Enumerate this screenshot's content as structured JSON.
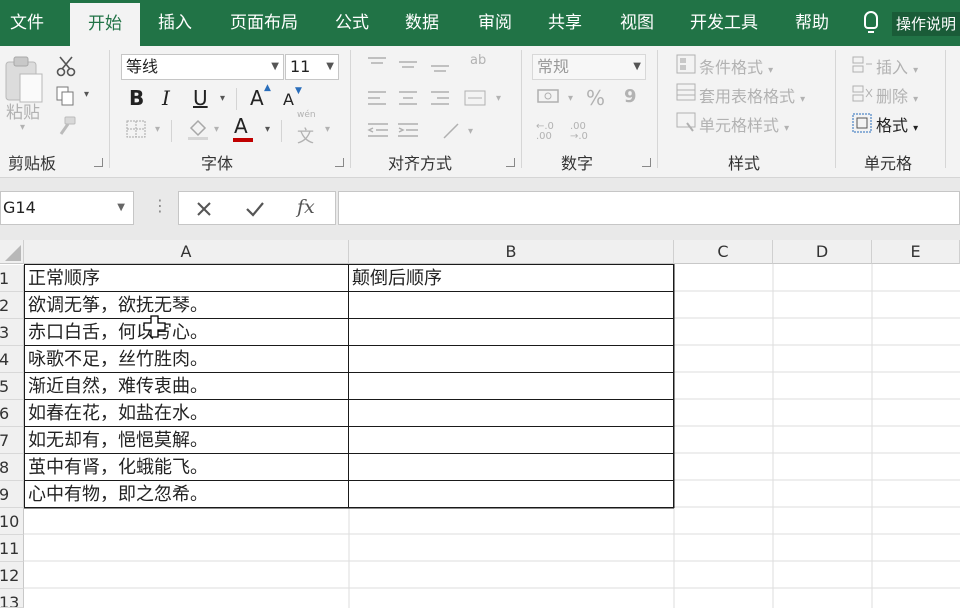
{
  "ribbon_tabs": [
    "文件",
    "开始",
    "插入",
    "页面布局",
    "公式",
    "数据",
    "审阅",
    "共享",
    "视图",
    "开发工具",
    "帮助"
  ],
  "active_tab": "开始",
  "help": {
    "label": "操作说明",
    "icon": "lightbulb-icon"
  },
  "clipboard": {
    "paste_label": "粘贴",
    "group_label": "剪贴板",
    "icons": [
      "paste-icon",
      "cut-icon",
      "copy-icon",
      "format-painter-icon"
    ]
  },
  "font": {
    "name": "等线",
    "size": "11",
    "bold": "B",
    "italic": "I",
    "underline": "U",
    "grow": "A",
    "shrink": "A",
    "font_color_letter": "A",
    "phonetic": "文",
    "phonetic_top": "wén",
    "group_label": "字体",
    "font_color": "#c00000"
  },
  "alignment": {
    "group_label": "对齐方式",
    "wrap_icon_text": "ab"
  },
  "number": {
    "format": "常规",
    "percent": "%",
    "comma": "9",
    "inc_decimal": ".00",
    "dec_decimal": ".0",
    "group_label": "数字"
  },
  "styles": {
    "items": [
      "条件格式",
      "套用表格格式",
      "单元格样式"
    ],
    "group_label": "样式"
  },
  "cells_group": {
    "items": [
      "插入",
      "删除",
      "格式"
    ],
    "group_label": "单元格"
  },
  "formula_bar": {
    "name_box": "G14",
    "fx": "fx",
    "value": ""
  },
  "sheet": {
    "columns": [
      "A",
      "B",
      "C",
      "D",
      "E"
    ],
    "rows": [
      "1",
      "2",
      "3",
      "4",
      "5",
      "6",
      "7",
      "8",
      "9",
      "10",
      "11",
      "12",
      "13"
    ],
    "cells": {
      "A1": "正常顺序",
      "B1": "颠倒后顺序",
      "A2": "欲调无筝，欲抚无琴。",
      "A3": "赤口白舌，何以写心。",
      "A4": "咏歌不足，丝竹胜肉。",
      "A5": "渐近自然，难传衷曲。",
      "A6": "如春在花，如盐在水。",
      "A7": "如无却有，悒悒莫解。",
      "A8": "茧中有肾，化蛾能飞。",
      "A9": "心中有物，即之忽希。"
    }
  },
  "colors": {
    "ribbon_green": "#217346",
    "ribbon_bg": "#f3f3f3"
  }
}
